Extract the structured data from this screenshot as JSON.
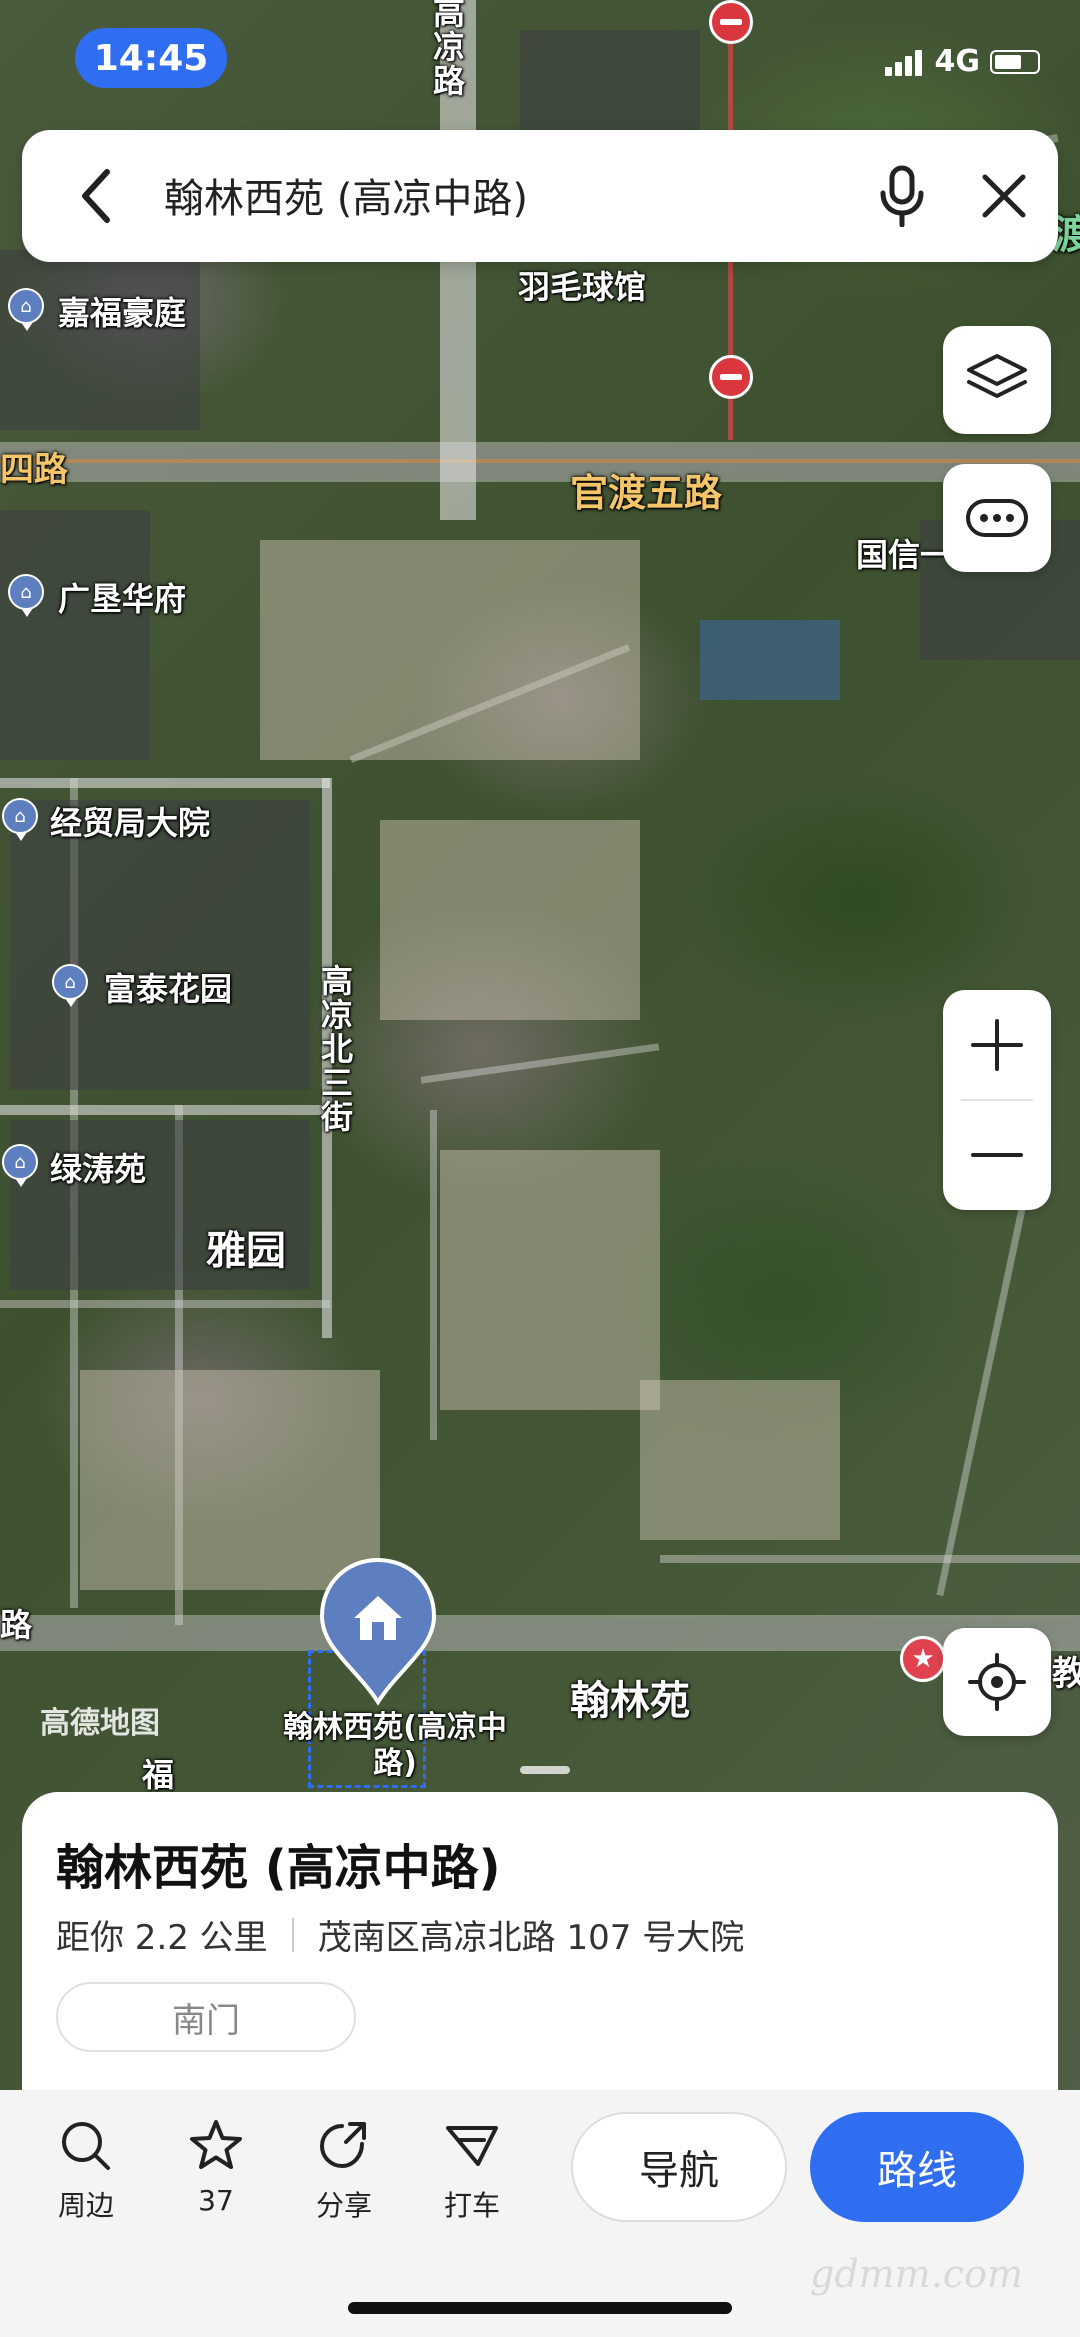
{
  "status_bar": {
    "time": "14:45",
    "network": "4G"
  },
  "search": {
    "query": "翰林西苑 (高凉中路)"
  },
  "map": {
    "labels": {
      "road_gaoliang_north": "高凉路",
      "poi_badminton": "羽毛球馆",
      "poi_jiafu": "嘉福豪庭",
      "road_left": "四路",
      "road_guandu5": "官渡五路",
      "poi_guoxin": "国信一",
      "poi_guangken": "广垦华府",
      "poi_jingmao": "经贸局大院",
      "poi_futai": "富泰花园",
      "road_gaoliang_n3": "高凉北三街",
      "poi_lvtao": "绿涛苑",
      "area_yayuan": "雅园",
      "poi_hanlinyuan": "翰林苑",
      "selected_place_label": "翰林西苑(高凉中路)",
      "map_logo": "高德地图",
      "fu_char": "福",
      "edge_char_left": "路",
      "edge_char_right": "教",
      "edge_char_top_right": "渡"
    }
  },
  "place_card": {
    "title": "翰林西苑 (高凉中路)",
    "distance": "距你 2.2 公里",
    "address": "茂南区高凉北路 107 号大院",
    "gate_chip": "南门"
  },
  "actions": {
    "nearby": "周边",
    "favorites_count": "37",
    "share": "分享",
    "taxi": "打车",
    "navigate": "导航",
    "route": "路线"
  },
  "watermark": "gdmm.com",
  "colors": {
    "accent": "#2f6ef0",
    "poi_pin": "#5d7fbf",
    "no_entry": "#d9363e"
  }
}
